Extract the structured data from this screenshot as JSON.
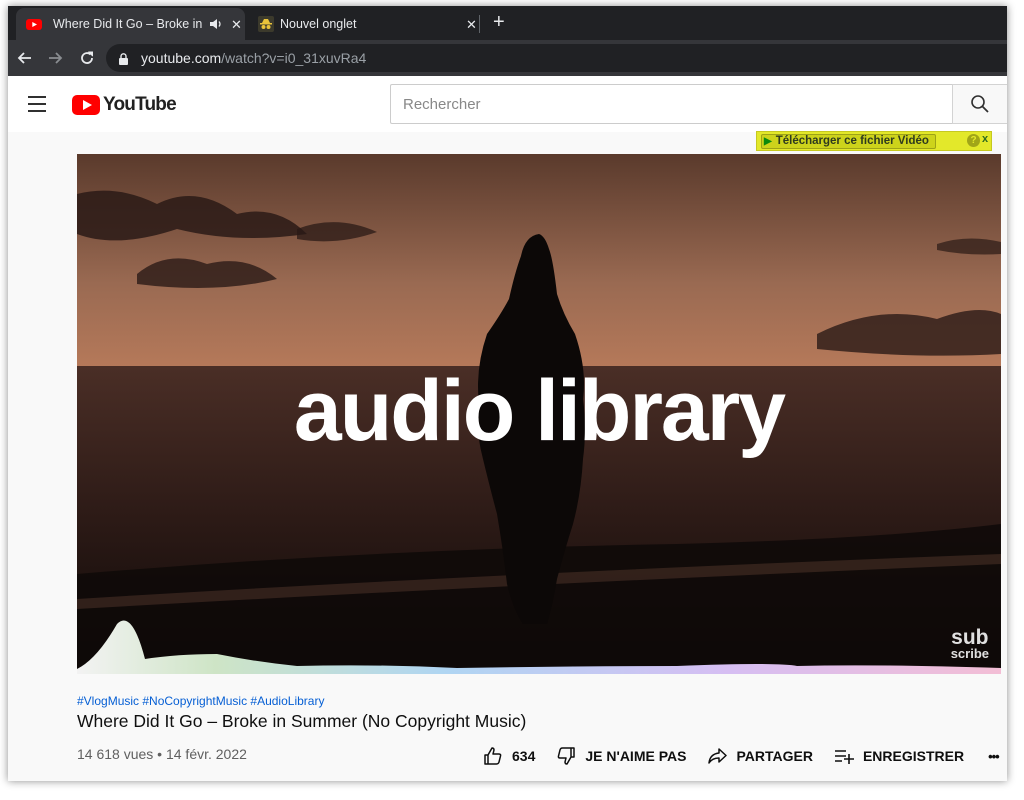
{
  "browser": {
    "tabs": [
      {
        "title": "Where Did It Go – Broke in Summer (No Copyright Music)",
        "active": true
      },
      {
        "title": "Nouvel onglet",
        "active": false
      }
    ],
    "url": {
      "host": "youtube.com",
      "path": "/watch?v=i0_31xuvRa4"
    }
  },
  "youtube": {
    "logo_text": "YouTube",
    "search_placeholder": "Rechercher"
  },
  "download_bar": {
    "label": "Télécharger ce fichier Vidéo",
    "help": "?",
    "close": "x"
  },
  "video": {
    "thumbnail_text": "audio library",
    "subscribe_line1": "sub",
    "subscribe_line2": "scribe",
    "hashtags": "#VlogMusic #NoCopyrightMusic #AudioLibrary",
    "title": "Where Did It Go – Broke in Summer (No Copyright Music)",
    "meta": "14 618 vues • 14 févr. 2022",
    "likes": "634",
    "dislike_label": "JE N'AIME PAS",
    "share_label": "PARTAGER",
    "save_label": "ENREGISTRER",
    "more": "•••"
  },
  "colors": {
    "youtube_red": "#ff0000",
    "link_blue": "#065fd4",
    "download_bar": "#e3e82a",
    "browser_dark": "#202124"
  }
}
